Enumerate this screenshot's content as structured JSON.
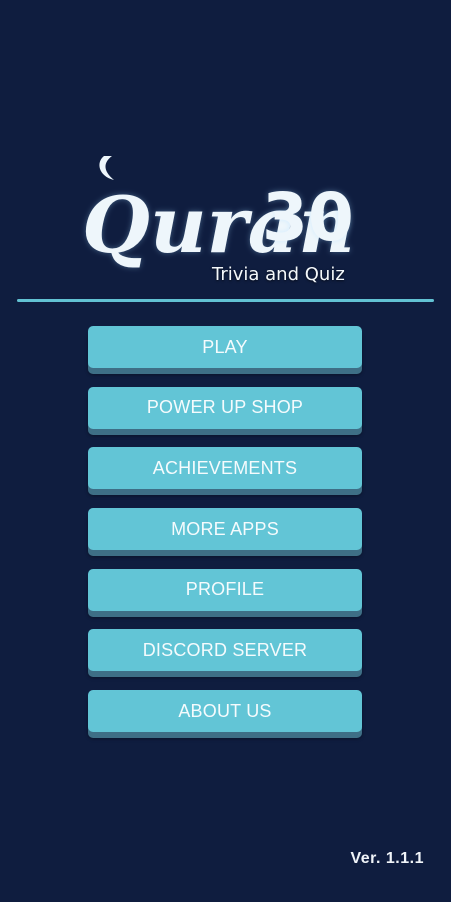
{
  "logo": {
    "word": "Quran",
    "number": "30",
    "subtitle": "Trivia and Quiz"
  },
  "menu": {
    "items": [
      {
        "label": "PLAY"
      },
      {
        "label": "POWER UP SHOP"
      },
      {
        "label": "ACHIEVEMENTS"
      },
      {
        "label": "MORE APPS"
      },
      {
        "label": "PROFILE"
      },
      {
        "label": "DISCORD SERVER"
      },
      {
        "label": "ABOUT US"
      }
    ]
  },
  "footer": {
    "version": "Ver. 1.1.1"
  },
  "colors": {
    "background": "#0f1d3f",
    "button": "#62c5d6",
    "button_shadow": "#3e6f86",
    "divider": "#62c2d3",
    "text": "#f5fbfd"
  }
}
